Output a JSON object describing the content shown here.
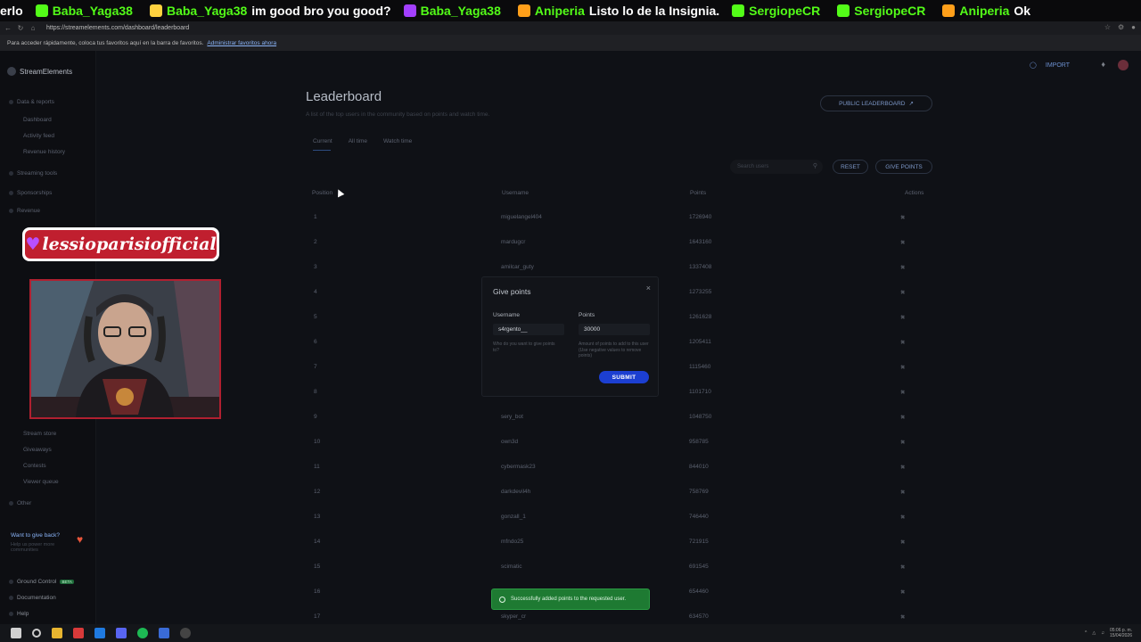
{
  "ticker": [
    {
      "name": "",
      "message": "erlo",
      "icon_color": ""
    },
    {
      "name": "Baba_Yaga38",
      "message": "",
      "icon_color": "#53fc18"
    },
    {
      "name": "Baba_Yaga38",
      "message": "im good bro you good?",
      "icon_color": "#ffd23f"
    },
    {
      "name": "Baba_Yaga38",
      "message": "",
      "icon_color": "#a33fff"
    },
    {
      "name": "Aniperia",
      "message": "Listo lo de la Insignia.",
      "icon_color": "#ff9f1a"
    },
    {
      "name": "SergiopeCR",
      "message": "",
      "icon_color": "#53fc18"
    },
    {
      "name": "SergiopeCR",
      "message": "",
      "icon_color": "#53fc18"
    },
    {
      "name": "Aniperia",
      "message": "Ok",
      "icon_color": "#ff9f1a"
    }
  ],
  "browser": {
    "url": "https://streamelements.com/dashboard/leaderboard",
    "favbar_text": "Para acceder rápidamente, coloca tus favoritos aquí en la barra de favoritos.",
    "favbar_link": "Administrar favoritos ahora"
  },
  "sidebar": {
    "brand": "StreamElements",
    "items": [
      {
        "label": "Data & reports",
        "level": 0
      },
      {
        "label": "Dashboard",
        "level": 1
      },
      {
        "label": "Activity feed",
        "level": 1
      },
      {
        "label": "Revenue history",
        "level": 1
      },
      {
        "label": "Streaming tools",
        "level": 0
      },
      {
        "label": "Sponsorships",
        "level": 0
      },
      {
        "label": "Revenue",
        "level": 0
      },
      {
        "label": "Stream store",
        "level": 1
      },
      {
        "label": "Giveaways",
        "level": 1
      },
      {
        "label": "Contests",
        "level": 1
      },
      {
        "label": "Viewer queue",
        "level": 1
      },
      {
        "label": "Other",
        "level": 0
      }
    ],
    "giveback_title": "Want to give back?",
    "giveback_sub": "Help us power more communities",
    "bottom": [
      {
        "label": "Ground Control",
        "badge": "BETA"
      },
      {
        "label": "Documentation",
        "badge": ""
      },
      {
        "label": "Help",
        "badge": ""
      }
    ]
  },
  "header": {
    "import_label": "IMPORT"
  },
  "page": {
    "title": "Leaderboard",
    "subtitle": "A list of the top users in the community based on points and watch time.",
    "public_button": "PUBLIC LEADERBOARD",
    "tabs": [
      "Current",
      "All time",
      "Watch time"
    ],
    "search_placeholder": "Search users",
    "reset_label": "RESET",
    "give_points_label": "GIVE POINTS"
  },
  "table": {
    "headers": {
      "position": "Position",
      "username": "Username",
      "points": "Points",
      "actions": "Actions"
    },
    "rows": [
      {
        "pos": "1",
        "user": "miguelangel404",
        "pts": "1726940"
      },
      {
        "pos": "2",
        "user": "mardugcr",
        "pts": "1643160"
      },
      {
        "pos": "3",
        "user": "amilcar_guty",
        "pts": "1337408"
      },
      {
        "pos": "4",
        "user": "",
        "pts": "1273255"
      },
      {
        "pos": "5",
        "user": "",
        "pts": "1261628"
      },
      {
        "pos": "6",
        "user": "",
        "pts": "1205411"
      },
      {
        "pos": "7",
        "user": "",
        "pts": "1115460"
      },
      {
        "pos": "8",
        "user": "",
        "pts": "1101710"
      },
      {
        "pos": "9",
        "user": "sery_bot",
        "pts": "1048750"
      },
      {
        "pos": "10",
        "user": "own3d",
        "pts": "958785"
      },
      {
        "pos": "11",
        "user": "cybermask23",
        "pts": "844010"
      },
      {
        "pos": "12",
        "user": "darkdevil4h",
        "pts": "758769"
      },
      {
        "pos": "13",
        "user": "gonzall_1",
        "pts": "746440"
      },
      {
        "pos": "14",
        "user": "mfndo25",
        "pts": "721915"
      },
      {
        "pos": "15",
        "user": "scimatic",
        "pts": "691545"
      },
      {
        "pos": "16",
        "user": "",
        "pts": "654460"
      },
      {
        "pos": "17",
        "user": "skyper_cr",
        "pts": "634570"
      }
    ]
  },
  "modal": {
    "title": "Give points",
    "username_label": "Username",
    "username_value": "s4rgento__",
    "username_hint": "Who do you want to give points to?",
    "points_label": "Points",
    "points_value": "30000",
    "points_hint": "Amount of points to add to this user (Use negative values to remove points)",
    "submit_label": "SUBMIT"
  },
  "toast": {
    "message": "Successfully added points to the requested user."
  },
  "overlay": {
    "name_tag": "lessioparisiofficial"
  },
  "taskbar": {
    "time": "05:06 p. m.",
    "date": "15/04/2026"
  }
}
